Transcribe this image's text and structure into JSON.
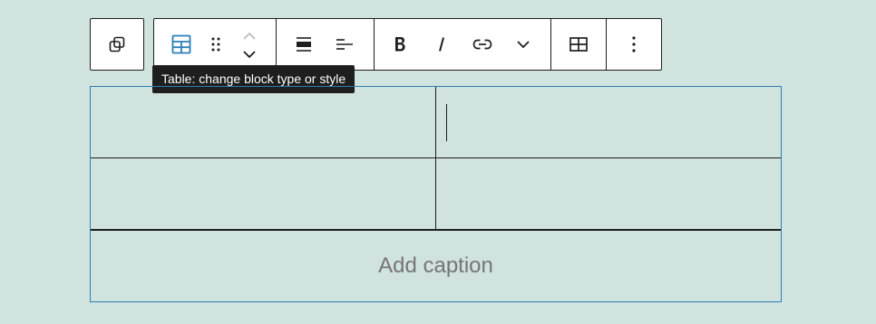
{
  "toolbar": {
    "parent_group": [
      {
        "icon": "select-parent-icon",
        "name": "select-parent-button"
      }
    ],
    "main_group": [
      {
        "icon": "table-icon",
        "name": "block-type-button",
        "accent": "#2a7fb8"
      },
      {
        "icon": "drag-handle-icon",
        "name": "drag-handle-button"
      },
      {
        "icon": "chevron-up-icon",
        "name": "move-up-button"
      },
      {
        "icon": "chevron-down-icon",
        "name": "move-down-button"
      },
      {
        "icon": "align-wide-icon",
        "name": "align-button"
      },
      {
        "icon": "align-text-left-icon",
        "name": "text-align-button"
      },
      {
        "icon": "bold-icon",
        "name": "bold-button"
      },
      {
        "icon": "italic-icon",
        "name": "italic-button"
      },
      {
        "icon": "link-icon",
        "name": "link-button"
      },
      {
        "icon": "chevron-down-icon",
        "name": "more-rich-text-button"
      },
      {
        "icon": "table-edit-icon",
        "name": "edit-table-button"
      },
      {
        "icon": "more-vertical-icon",
        "name": "options-button"
      }
    ]
  },
  "tooltip": {
    "text": "Table: change block type or style"
  },
  "table": {
    "rows": [
      [
        "",
        ""
      ],
      [
        "",
        ""
      ]
    ],
    "active_cell": "row-1-col-2",
    "border_color": "#2a7fb8"
  },
  "caption": {
    "placeholder": "Add caption"
  },
  "colors": {
    "background": "#d1e3de",
    "toolbar_border": "#1e1e1e",
    "accent": "#2a7fb8",
    "tooltip_bg": "#1e1e1e",
    "caption_placeholder": "#757575"
  }
}
